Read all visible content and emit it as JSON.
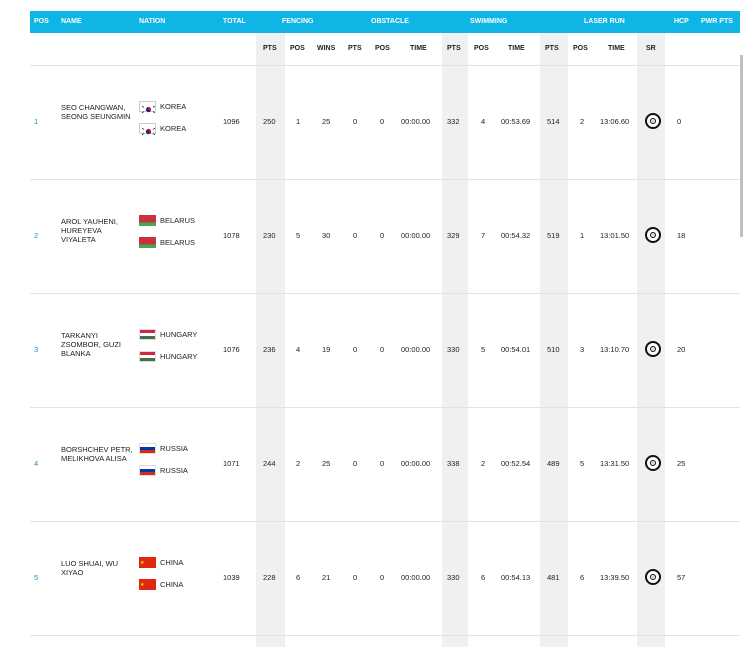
{
  "header": {
    "pos": "POS",
    "name": "NAME",
    "nation": "NATION",
    "total": "TOTAL",
    "fencing": "FENCING",
    "obstacle": "OBSTACLE",
    "swimming": "SWIMMING",
    "laser_run": "LASER RUN",
    "hcp": "HCP",
    "pwr_pts": "PWR PTS"
  },
  "subheader": {
    "f_pts": "PTS",
    "f_pos": "POS",
    "f_wins": "WINS",
    "o_pts": "PTS",
    "o_pos": "POS",
    "o_time": "TIME",
    "s_pts": "PTS",
    "s_pos": "POS",
    "s_time": "TIME",
    "l_pts": "PTS",
    "l_pos": "POS",
    "l_time": "TIME",
    "l_sr": "SR"
  },
  "rows": [
    {
      "pos": "1",
      "name": "SEO CHANGWAN, SEONG SEUNGMIN",
      "nation1": "KOREA",
      "nation2": "KOREA",
      "flag": "korea-flag-icon",
      "total": "1096",
      "f_pts": "250",
      "f_pos": "1",
      "f_wins": "25",
      "o_pts": "0",
      "o_pos": "0",
      "o_time": "00:00.00",
      "s_pts": "332",
      "s_pos": "4",
      "s_time": "00:53.69",
      "l_pts": "514",
      "l_pos": "2",
      "l_time": "13:06.60",
      "hcp": "0"
    },
    {
      "pos": "2",
      "name": "AROL YAUHENI, HUREYEVA VIYALETA",
      "nation1": "BELARUS",
      "nation2": "BELARUS",
      "flag": "belarus-flag-icon",
      "total": "1078",
      "f_pts": "230",
      "f_pos": "5",
      "f_wins": "30",
      "o_pts": "0",
      "o_pos": "0",
      "o_time": "00:00.00",
      "s_pts": "329",
      "s_pos": "7",
      "s_time": "00:54.32",
      "l_pts": "519",
      "l_pos": "1",
      "l_time": "13:01.50",
      "hcp": "18"
    },
    {
      "pos": "3",
      "name": "TARKANYI ZSOMBOR, GUZI BLANKA",
      "nation1": "HUNGARY",
      "nation2": "HUNGARY",
      "flag": "hungary-flag-icon",
      "total": "1076",
      "f_pts": "236",
      "f_pos": "4",
      "f_wins": "19",
      "o_pts": "0",
      "o_pos": "0",
      "o_time": "00:00.00",
      "s_pts": "330",
      "s_pos": "5",
      "s_time": "00:54.01",
      "l_pts": "510",
      "l_pos": "3",
      "l_time": "13:10.70",
      "hcp": "20"
    },
    {
      "pos": "4",
      "name": "BORSHCHEV PETR, MELIKHOVA ALISA",
      "nation1": "RUSSIA",
      "nation2": "RUSSIA",
      "flag": "russia-flag-icon",
      "total": "1071",
      "f_pts": "244",
      "f_pos": "2",
      "f_wins": "25",
      "o_pts": "0",
      "o_pos": "0",
      "o_time": "00:00.00",
      "s_pts": "338",
      "s_pos": "2",
      "s_time": "00:52.54",
      "l_pts": "489",
      "l_pos": "5",
      "l_time": "13:31.50",
      "hcp": "25"
    },
    {
      "pos": "5",
      "name": "LUO SHUAI, WU XIYAO",
      "nation1": "CHINA",
      "nation2": "CHINA",
      "flag": "china-flag-icon",
      "total": "1039",
      "f_pts": "228",
      "f_pos": "6",
      "f_wins": "21",
      "o_pts": "0",
      "o_pos": "0",
      "o_time": "00:00.00",
      "s_pts": "330",
      "s_pos": "6",
      "s_time": "00:54.13",
      "l_pts": "481",
      "l_pos": "6",
      "l_time": "13:39.50",
      "hcp": "57"
    }
  ],
  "colors": {
    "header_bg": "#0fb5e4",
    "pos_link": "#1a8fc4",
    "shade": "#f0f0f0"
  }
}
